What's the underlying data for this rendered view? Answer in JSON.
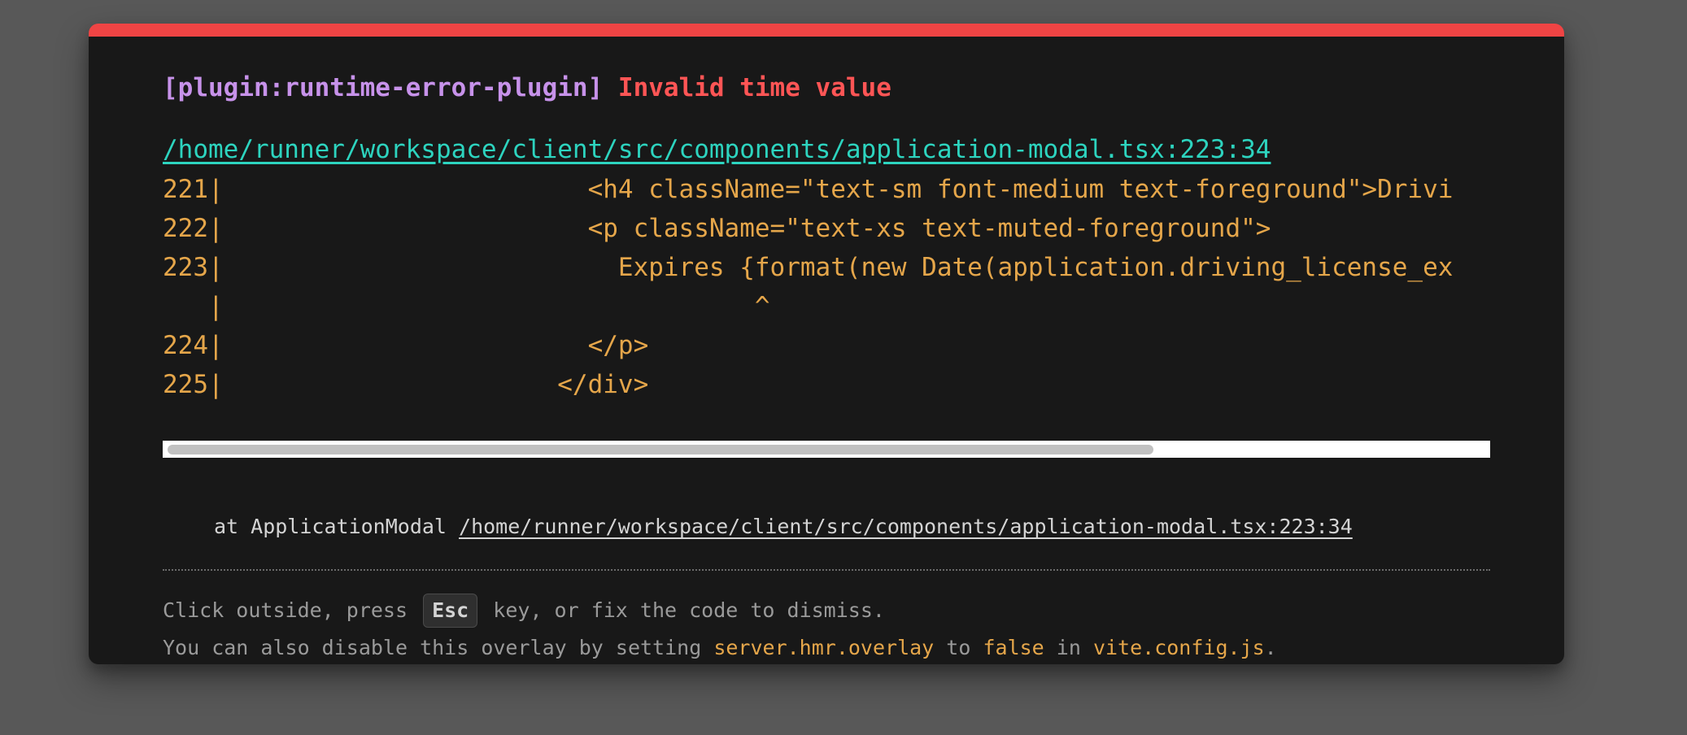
{
  "overlay": {
    "plugin_label": "[plugin:runtime-error-plugin]",
    "error_message": "Invalid time value",
    "file_location": "/home/runner/workspace/client/src/components/application-modal.tsx:223:34",
    "code_frame": [
      {
        "text": "221|                        <h4 className=\"text-sm font-medium text-foreground\">Drivi"
      },
      {
        "text": "222|                        <p className=\"text-xs text-muted-foreground\">"
      },
      {
        "text": "223|                          Expires {format(new Date(application.driving_license_ex"
      },
      {
        "text": "   |                                   ^"
      },
      {
        "text": "224|                        </p>"
      },
      {
        "text": "225|                      </div>"
      }
    ],
    "scroll_position": 0,
    "stack_prefix": "at ApplicationModal ",
    "stack_location": "/home/runner/workspace/client/src/components/application-modal.tsx:223:34",
    "tip_line1_before": "Click outside, press ",
    "tip_key": "Esc",
    "tip_line1_after": " key, or fix the code to dismiss.",
    "tip_line2_a": "You can also disable this overlay by setting ",
    "tip_line2_setting": "server.hmr.overlay",
    "tip_line2_b": " to ",
    "tip_line2_value": "false",
    "tip_line2_c": " in ",
    "tip_line2_file": "vite.config.js",
    "tip_line2_d": "."
  },
  "colors": {
    "accent_bar": "#ef4444",
    "plugin": "#c792ea",
    "error": "#ff5555",
    "link": "#2dd4bf",
    "code": "#e5a64a",
    "background": "#181818"
  }
}
